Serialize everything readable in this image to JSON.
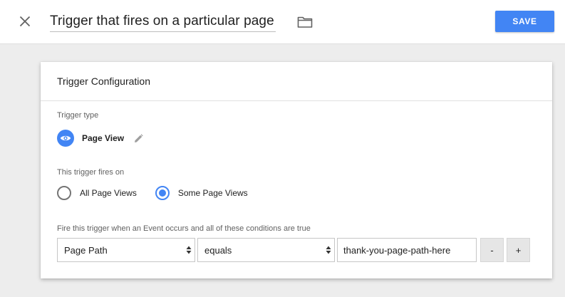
{
  "header": {
    "title": "Trigger that fires on a particular page",
    "save_label": "SAVE"
  },
  "card": {
    "heading": "Trigger Configuration",
    "trigger_type_label": "Trigger type",
    "trigger_type_value": "Page View",
    "fires_on_label": "This trigger fires on",
    "fires_on_options": [
      {
        "label": "All Page Views",
        "selected": false
      },
      {
        "label": "Some Page Views",
        "selected": true
      }
    ],
    "condition_label": "Fire this trigger when an Event occurs and all of these conditions are true",
    "condition": {
      "variable": "Page Path",
      "operator": "equals",
      "value": "thank-you-page-path-here"
    },
    "remove_label": "-",
    "add_label": "+"
  },
  "colors": {
    "accent": "#4285f4",
    "background": "#ededed"
  },
  "icons": [
    "close-icon",
    "folder-icon",
    "eye-icon",
    "pencil-icon",
    "updown-arrow-icon"
  ]
}
